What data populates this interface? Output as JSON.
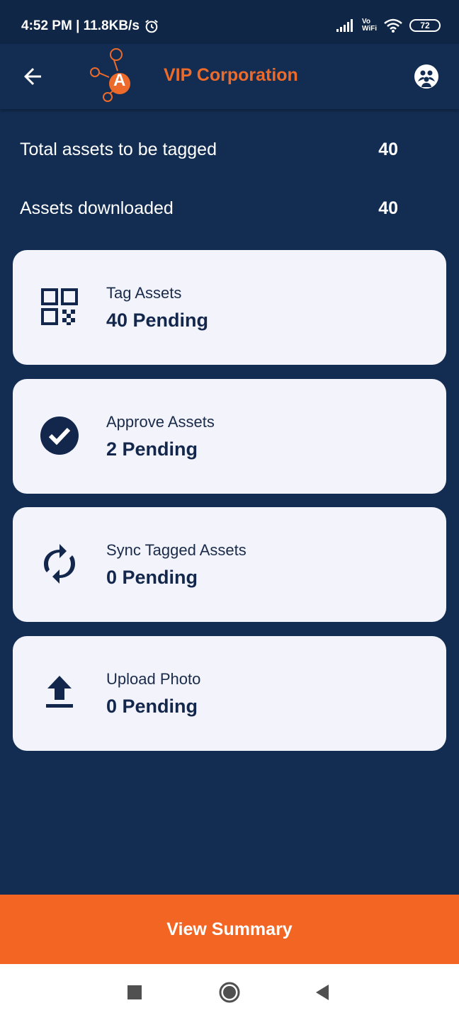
{
  "status_bar": {
    "time_speed": "4:52 PM | 11.8KB/s",
    "vowifi": "Vo\nWiFi",
    "battery": "72"
  },
  "header": {
    "title": "VIP Corporation",
    "logo_letter": "A",
    "accent_color": "#ec6a2a"
  },
  "summary": {
    "rows": [
      {
        "label": "Total assets to be tagged",
        "value": "40"
      },
      {
        "label": "Assets downloaded",
        "value": "40"
      }
    ]
  },
  "cards": [
    {
      "title": "Tag Assets",
      "count": "40 Pending",
      "icon": "qr-code-icon"
    },
    {
      "title": "Approve Assets",
      "count": "2 Pending",
      "icon": "check-circle-icon"
    },
    {
      "title": "Sync Tagged Assets",
      "count": "0 Pending",
      "icon": "sync-icon"
    },
    {
      "title": "Upload Photo",
      "count": "0 Pending",
      "icon": "upload-icon"
    }
  ],
  "footer": {
    "button_label": "View Summary",
    "button_color": "#f26522"
  }
}
